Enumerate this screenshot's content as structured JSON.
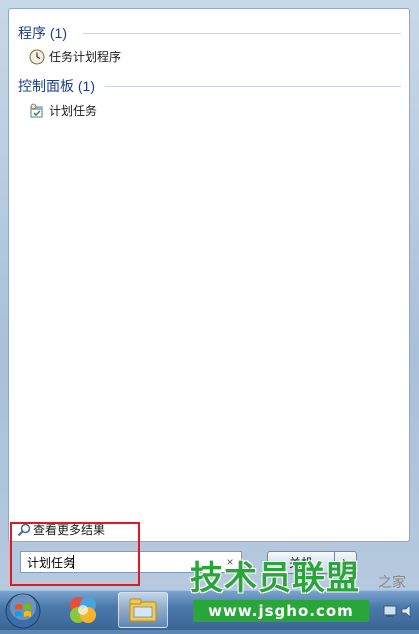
{
  "results": {
    "groups": [
      {
        "header": "程序 (1)",
        "items": [
          {
            "label": "任务计划程序",
            "icon": "clock-icon"
          }
        ]
      },
      {
        "header": "控制面板 (1)",
        "items": [
          {
            "label": "计划任务",
            "icon": "scheduled-tasks-icon"
          }
        ]
      }
    ]
  },
  "see_more": {
    "label": "查看更多结果",
    "icon": "search-icon"
  },
  "search": {
    "value": "计划任务",
    "clear": "×"
  },
  "shutdown": {
    "label": "关机",
    "arrow_icon": "arrow-right-icon"
  },
  "watermark": {
    "brand": "技术员联盟",
    "sub": "之家",
    "url": "www.jsgho.com"
  },
  "colors": {
    "header": "#1e3f8c",
    "highlight": "#e0191f",
    "watermark": "#2aa53a"
  }
}
